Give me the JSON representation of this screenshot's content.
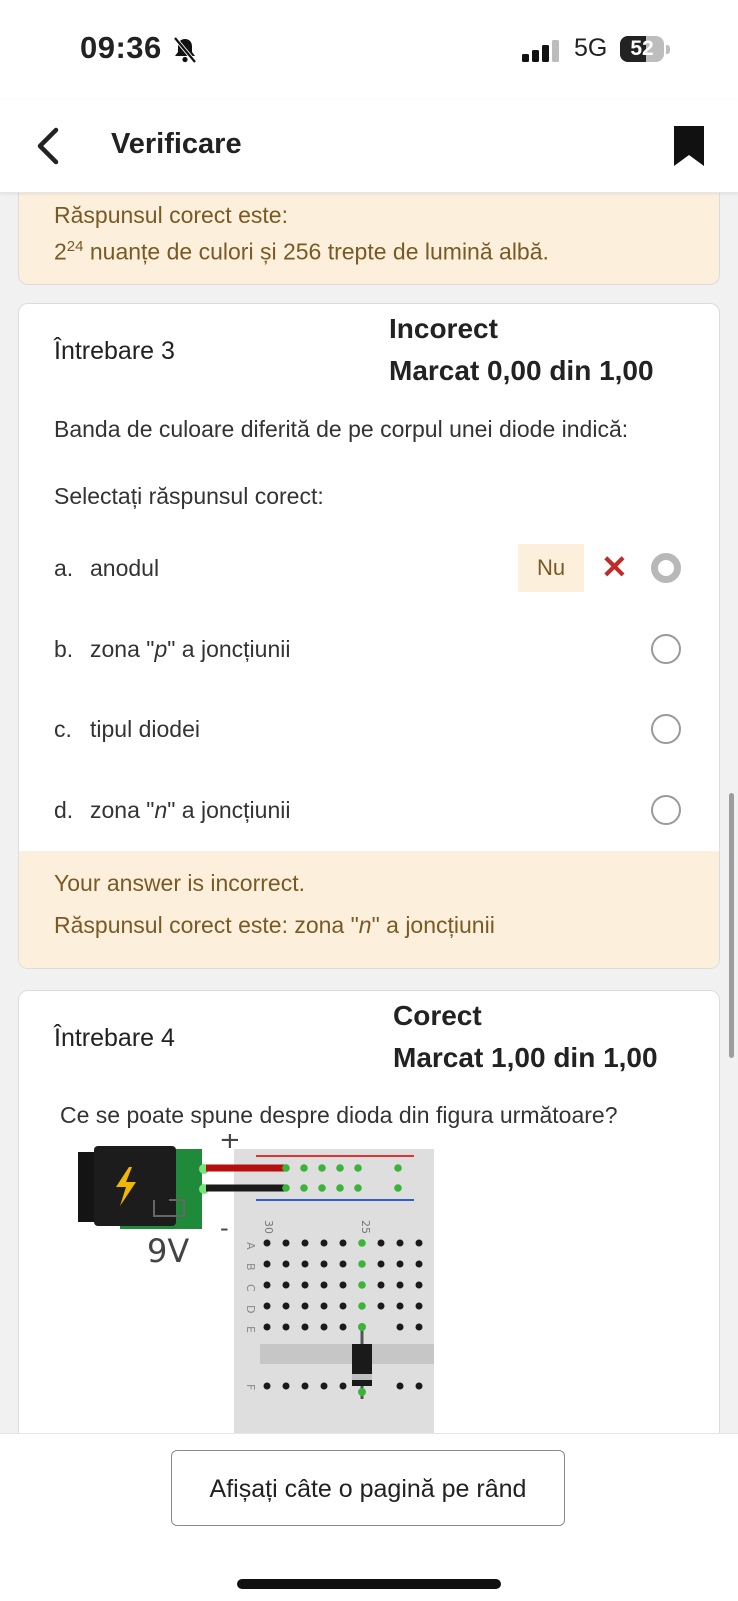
{
  "status_bar": {
    "time": "09:36",
    "network": "5G",
    "battery": "52"
  },
  "header": {
    "title": "Verificare"
  },
  "q2_feedback": {
    "line1": "Răspunsul corect este:",
    "base": "2",
    "exponent": "24",
    "rest": " nuanțe de culori și 256 trepte de lumină albă."
  },
  "question3": {
    "label": "Întrebare 3",
    "state": "Incorect",
    "grade": "Marcat 0,00 din 1,00",
    "text": "Banda de culoare diferită de pe corpul unei diode indică:",
    "prompt": "Selectați răspunsul corect:",
    "options": [
      {
        "letter": "a.",
        "text": "anodul",
        "checked": true
      },
      {
        "letter": "b.",
        "pre": "zona \"",
        "em": "p",
        "post": "\" a joncțiunii",
        "checked": false
      },
      {
        "letter": "c.",
        "text": "tipul diodei",
        "checked": false
      },
      {
        "letter": "d.",
        "pre": "zona \"",
        "em": "n",
        "post": "\" a joncțiunii",
        "checked": false
      }
    ],
    "selected_feedback": "Nu",
    "feedback_1": "Your answer is incorrect.",
    "feedback_2_pre": "Răspunsul corect este: zona \"",
    "feedback_2_em": "n",
    "feedback_2_post": "\" a joncțiunii"
  },
  "question4": {
    "label": "Întrebare 4",
    "state": "Corect",
    "grade": "Marcat 1,00 din 1,00",
    "text": "Ce se poate spune despre dioda din figura următoare?",
    "figure": {
      "battery_label": "9V",
      "plus": "+",
      "minus": "-",
      "col_30": "30",
      "col_25": "25",
      "rows": [
        "A",
        "B",
        "C",
        "D",
        "E",
        "F"
      ]
    }
  },
  "footer": {
    "page_button": "Afișați câte o pagină pe rând"
  },
  "colors": {
    "feedback_bg": "#fcefdc",
    "feedback_text": "#7a5a24",
    "incorrect_mark": "#c62828"
  }
}
